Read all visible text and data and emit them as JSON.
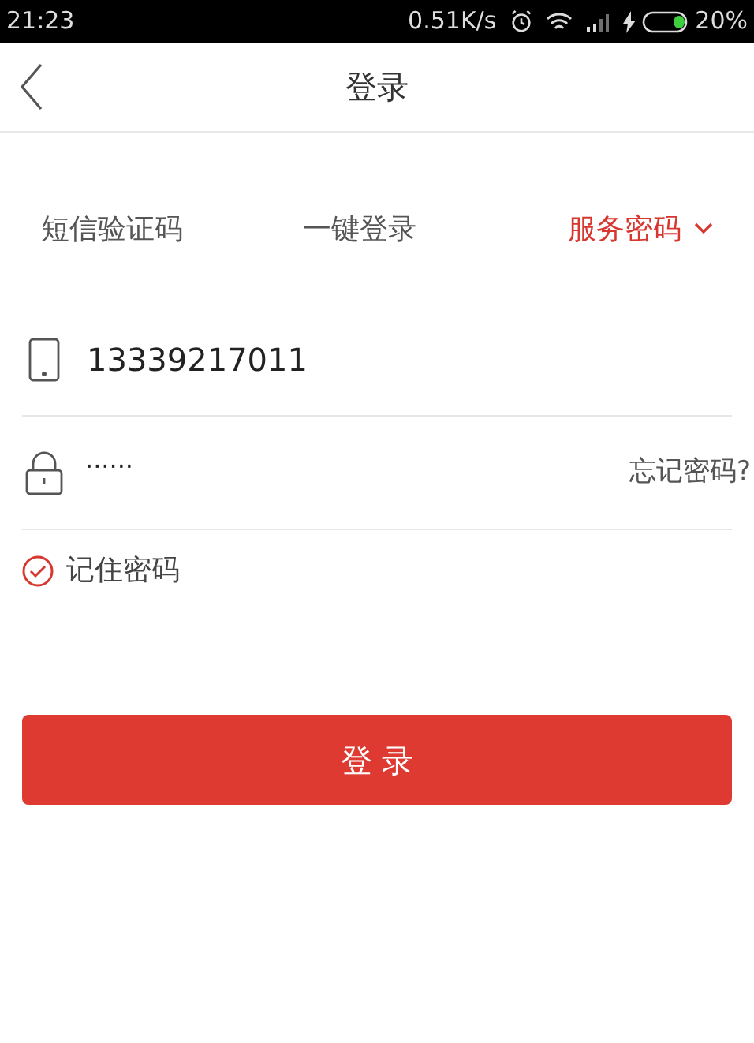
{
  "status_bar": {
    "time": "21:23",
    "speed": "0.51K/s",
    "battery": "20%"
  },
  "header": {
    "title": "登录"
  },
  "tabs": [
    {
      "label": "短信验证码",
      "selected": false
    },
    {
      "label": "一键登录",
      "selected": false
    },
    {
      "label": "服务密码",
      "selected": true
    }
  ],
  "phone_field": {
    "value": "13339217011"
  },
  "password_field": {
    "value": "······",
    "forgot_link": "忘记密码?"
  },
  "remember": {
    "label": "记住密码",
    "checked": true
  },
  "login_button": {
    "label": "登 录"
  }
}
